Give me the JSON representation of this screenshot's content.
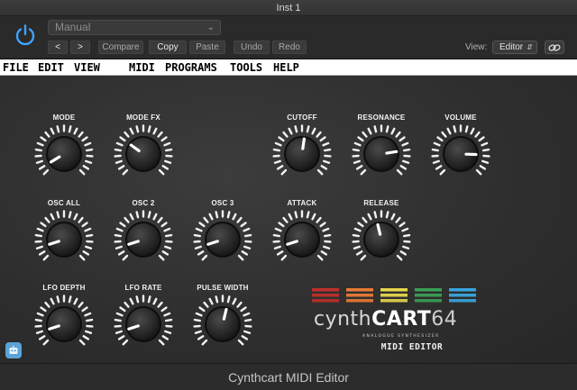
{
  "window": {
    "title": "Inst 1"
  },
  "toolbar": {
    "preset_value": "Manual",
    "prev_label": "<",
    "next_label": ">",
    "compare_label": "Compare",
    "copy_label": "Copy",
    "paste_label": "Paste",
    "undo_label": "Undo",
    "redo_label": "Redo",
    "view_label": "View:",
    "view_value": "Editor"
  },
  "menubar": {
    "items": [
      "FILE",
      "EDIT",
      "VIEW",
      "MIDI",
      "PROGRAMS",
      "TOOLS",
      "HELP"
    ]
  },
  "knobs": [
    {
      "id": "mode",
      "label": "MODE",
      "value": 0.05
    },
    {
      "id": "mode-fx",
      "label": "MODE FX",
      "value": 0.3
    },
    {
      "id": "cutoff",
      "label": "CUTOFF",
      "value": 0.53
    },
    {
      "id": "resonance",
      "label": "RESONANCE",
      "value": 0.8
    },
    {
      "id": "volume",
      "label": "VOLUME",
      "value": 0.84
    },
    {
      "id": "osc-all",
      "label": "OSC ALL",
      "value": 0.1
    },
    {
      "id": "osc-2",
      "label": "OSC 2",
      "value": 0.1
    },
    {
      "id": "osc-3",
      "label": "OSC 3",
      "value": 0.1
    },
    {
      "id": "attack",
      "label": "ATTACK",
      "value": 0.1
    },
    {
      "id": "release",
      "label": "RELEASE",
      "value": 0.45
    },
    {
      "id": "lfo-depth",
      "label": "LFO DEPTH",
      "value": 0.1
    },
    {
      "id": "lfo-rate",
      "label": "LFO RATE",
      "value": 0.1
    },
    {
      "id": "pulse-width",
      "label": "PULSE WIDTH",
      "value": 0.55
    }
  ],
  "brand": {
    "prefix": "cynth",
    "main": "CART",
    "number": "64",
    "tagline": "ANALOGUE SYNTHESIZER",
    "caption": "MIDI EDITOR",
    "stripe_colors": [
      "#c0302b",
      "#e87a35",
      "#e6d64d",
      "#3aa055",
      "#38a6df"
    ]
  },
  "footer": {
    "title": "Cynthcart MIDI Editor"
  },
  "colors": {
    "accent": "#3fa2ff",
    "menubar_bg": "#ffffff",
    "panel_bg": "#333333"
  }
}
